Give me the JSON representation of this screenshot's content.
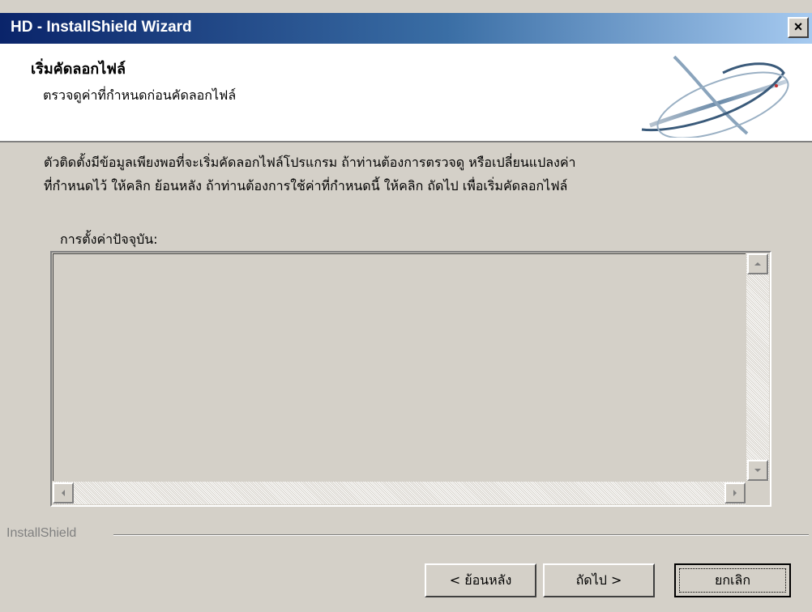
{
  "window": {
    "title": "HD - InstallShield Wizard",
    "close_glyph": "×"
  },
  "header": {
    "title": "เริ่มคัดลอกไฟล์",
    "subtitle": "ตรวจดูค่าที่กำหนดก่อนคัดลอกไฟล์",
    "graphic_icon": "installshield-swoosh-logo"
  },
  "body": {
    "description_line1": "ตัวติดตั้งมีข้อมูลเพียงพอที่จะเริ่มคัดลอกไฟล์โปรแกรม  ถ้าท่านต้องการตรวจดู หรือเปลี่ยนแปลงค่า",
    "description_line2": "ที่กำหนดไว้ ให้คลิก ย้อนหลัง  ถ้าท่านต้องการใช้ค่าที่กำหนดนี้ ให้คลิก ถัดไป เพื่อเริ่มคัดลอกไฟล์",
    "settings_label": "การตั้งค่าปัจจุบัน:",
    "settings_value": ""
  },
  "footer": {
    "brand": "InstallShield",
    "back_label": "< ย้อนหลัง",
    "next_label": "ถัดไป >",
    "cancel_label": "ยกเลิก"
  },
  "colors": {
    "title_start": "#0a246a",
    "title_end": "#a6caf0",
    "face": "#d4d0c8"
  }
}
